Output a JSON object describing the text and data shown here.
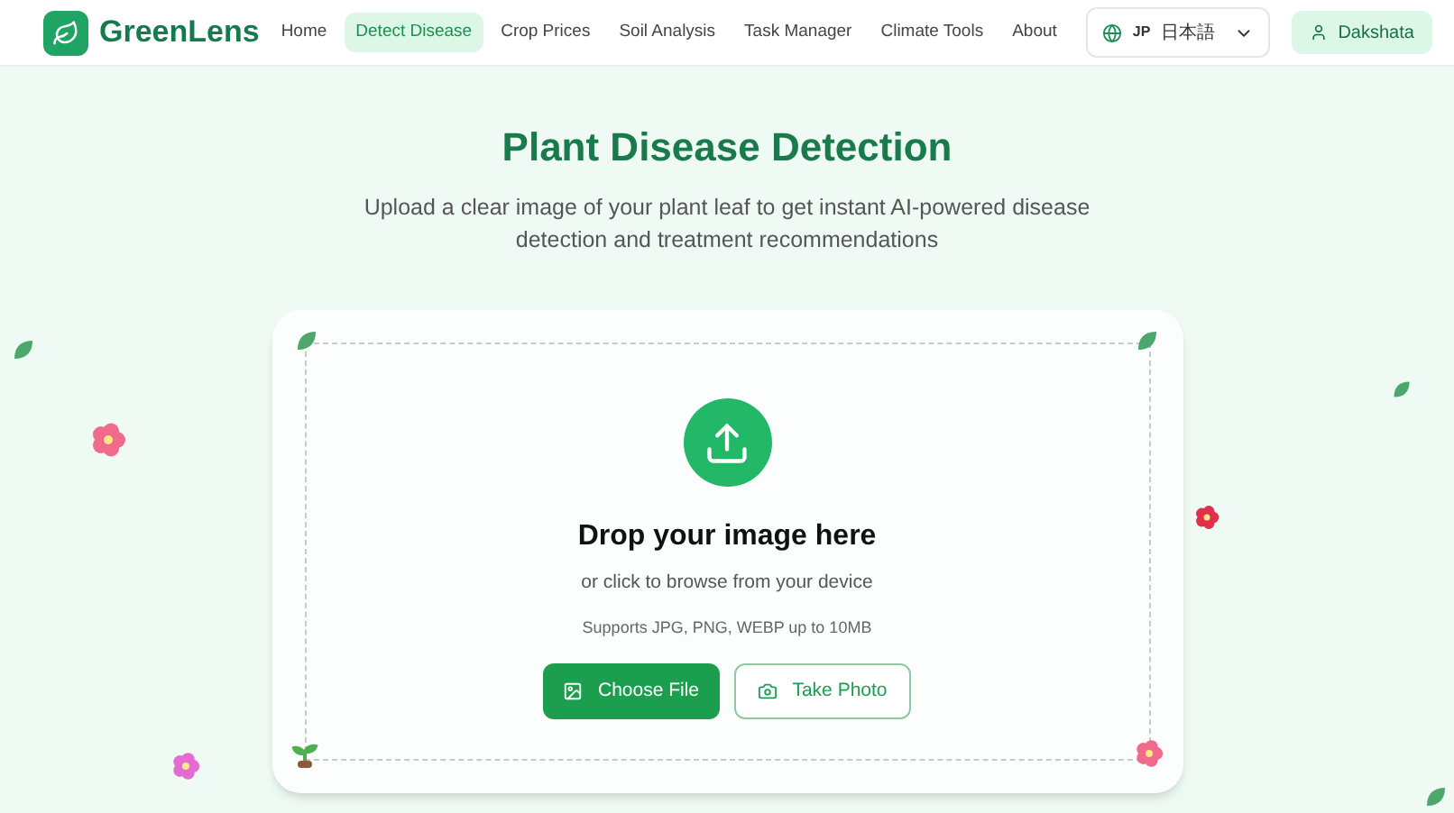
{
  "brand": "GreenLens",
  "nav": [
    {
      "label": "Home",
      "selected": false
    },
    {
      "label": "Detect Disease",
      "selected": true
    },
    {
      "label": "Crop Prices",
      "selected": false
    },
    {
      "label": "Soil Analysis",
      "selected": false
    },
    {
      "label": "Task Manager",
      "selected": false
    },
    {
      "label": "Climate Tools",
      "selected": false
    },
    {
      "label": "About",
      "selected": false
    }
  ],
  "language": {
    "code": "JP",
    "name": "日本語"
  },
  "user": "Dakshata",
  "title": "Plant Disease Detection",
  "subtitle": "Upload a clear image of your plant leaf to get instant AI-powered disease detection and treatment recommendations",
  "upload": {
    "heading": "Drop your image here",
    "hint": "or click to browse from your device",
    "formats": "Supports JPG, PNG, WEBP up to 10MB"
  },
  "buttons": [
    {
      "label": "Choose File",
      "kind": "primary"
    },
    {
      "label": "Take Photo",
      "kind": "outline"
    }
  ]
}
